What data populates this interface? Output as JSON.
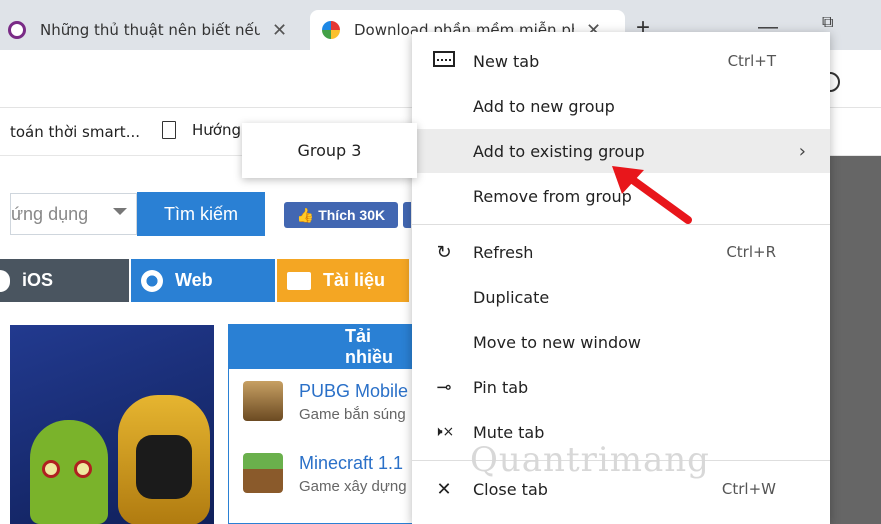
{
  "tabs": [
    {
      "title": "Những thủ thuật nên biết nếu",
      "close": "✕"
    },
    {
      "title": "Download phần mềm miễn phí",
      "close": "✕"
    }
  ],
  "window": {
    "new_tab": "+",
    "minimize": "—",
    "restore": "⧉"
  },
  "bookmarks": [
    {
      "label": "toán thời smart..."
    },
    {
      "label": "Hướng"
    }
  ],
  "page": {
    "search_placeholder": "ứng dụng",
    "search_button": "Tìm kiếm",
    "like_button": "👍 Thích 30K",
    "nav": [
      {
        "label": "iOS"
      },
      {
        "label": "Web"
      },
      {
        "label": "Tài liệu"
      }
    ],
    "downloads_title": "Tải nhiều",
    "downloads": [
      {
        "name": "PUBG Mobile",
        "desc": "Game bắn súng"
      },
      {
        "name": "Minecraft 1.1",
        "desc": "Game xây dựng"
      }
    ]
  },
  "context_menu": {
    "items": [
      {
        "label": "New tab",
        "shortcut": "Ctrl+T",
        "icon": "new-tab-icon"
      },
      {
        "label": "Add to new group",
        "shortcut": "",
        "icon": ""
      },
      {
        "label": "Add to existing group",
        "shortcut": "",
        "icon": "",
        "arrow": "›"
      },
      {
        "label": "Remove from group",
        "shortcut": "",
        "icon": ""
      },
      {
        "label": "Refresh",
        "shortcut": "Ctrl+R",
        "icon": "refresh-icon"
      },
      {
        "label": "Duplicate",
        "shortcut": "",
        "icon": ""
      },
      {
        "label": "Move to new window",
        "shortcut": "",
        "icon": ""
      },
      {
        "label": "Pin tab",
        "shortcut": "",
        "icon": "pin-icon"
      },
      {
        "label": "Mute tab",
        "shortcut": "",
        "icon": "mute-icon"
      },
      {
        "label": "Close tab",
        "shortcut": "Ctrl+W",
        "icon": "close-icon"
      }
    ]
  },
  "submenu": {
    "items": [
      {
        "label": "Group 3"
      }
    ]
  },
  "icons": {
    "refresh": "↻",
    "pin": "⊸",
    "mute": "🕨×",
    "close": "✕"
  },
  "watermark": "Quantrimang",
  "colors": {
    "accent": "#2a80d4",
    "annotation": "#e8161b",
    "menu_hover": "#ececec"
  }
}
